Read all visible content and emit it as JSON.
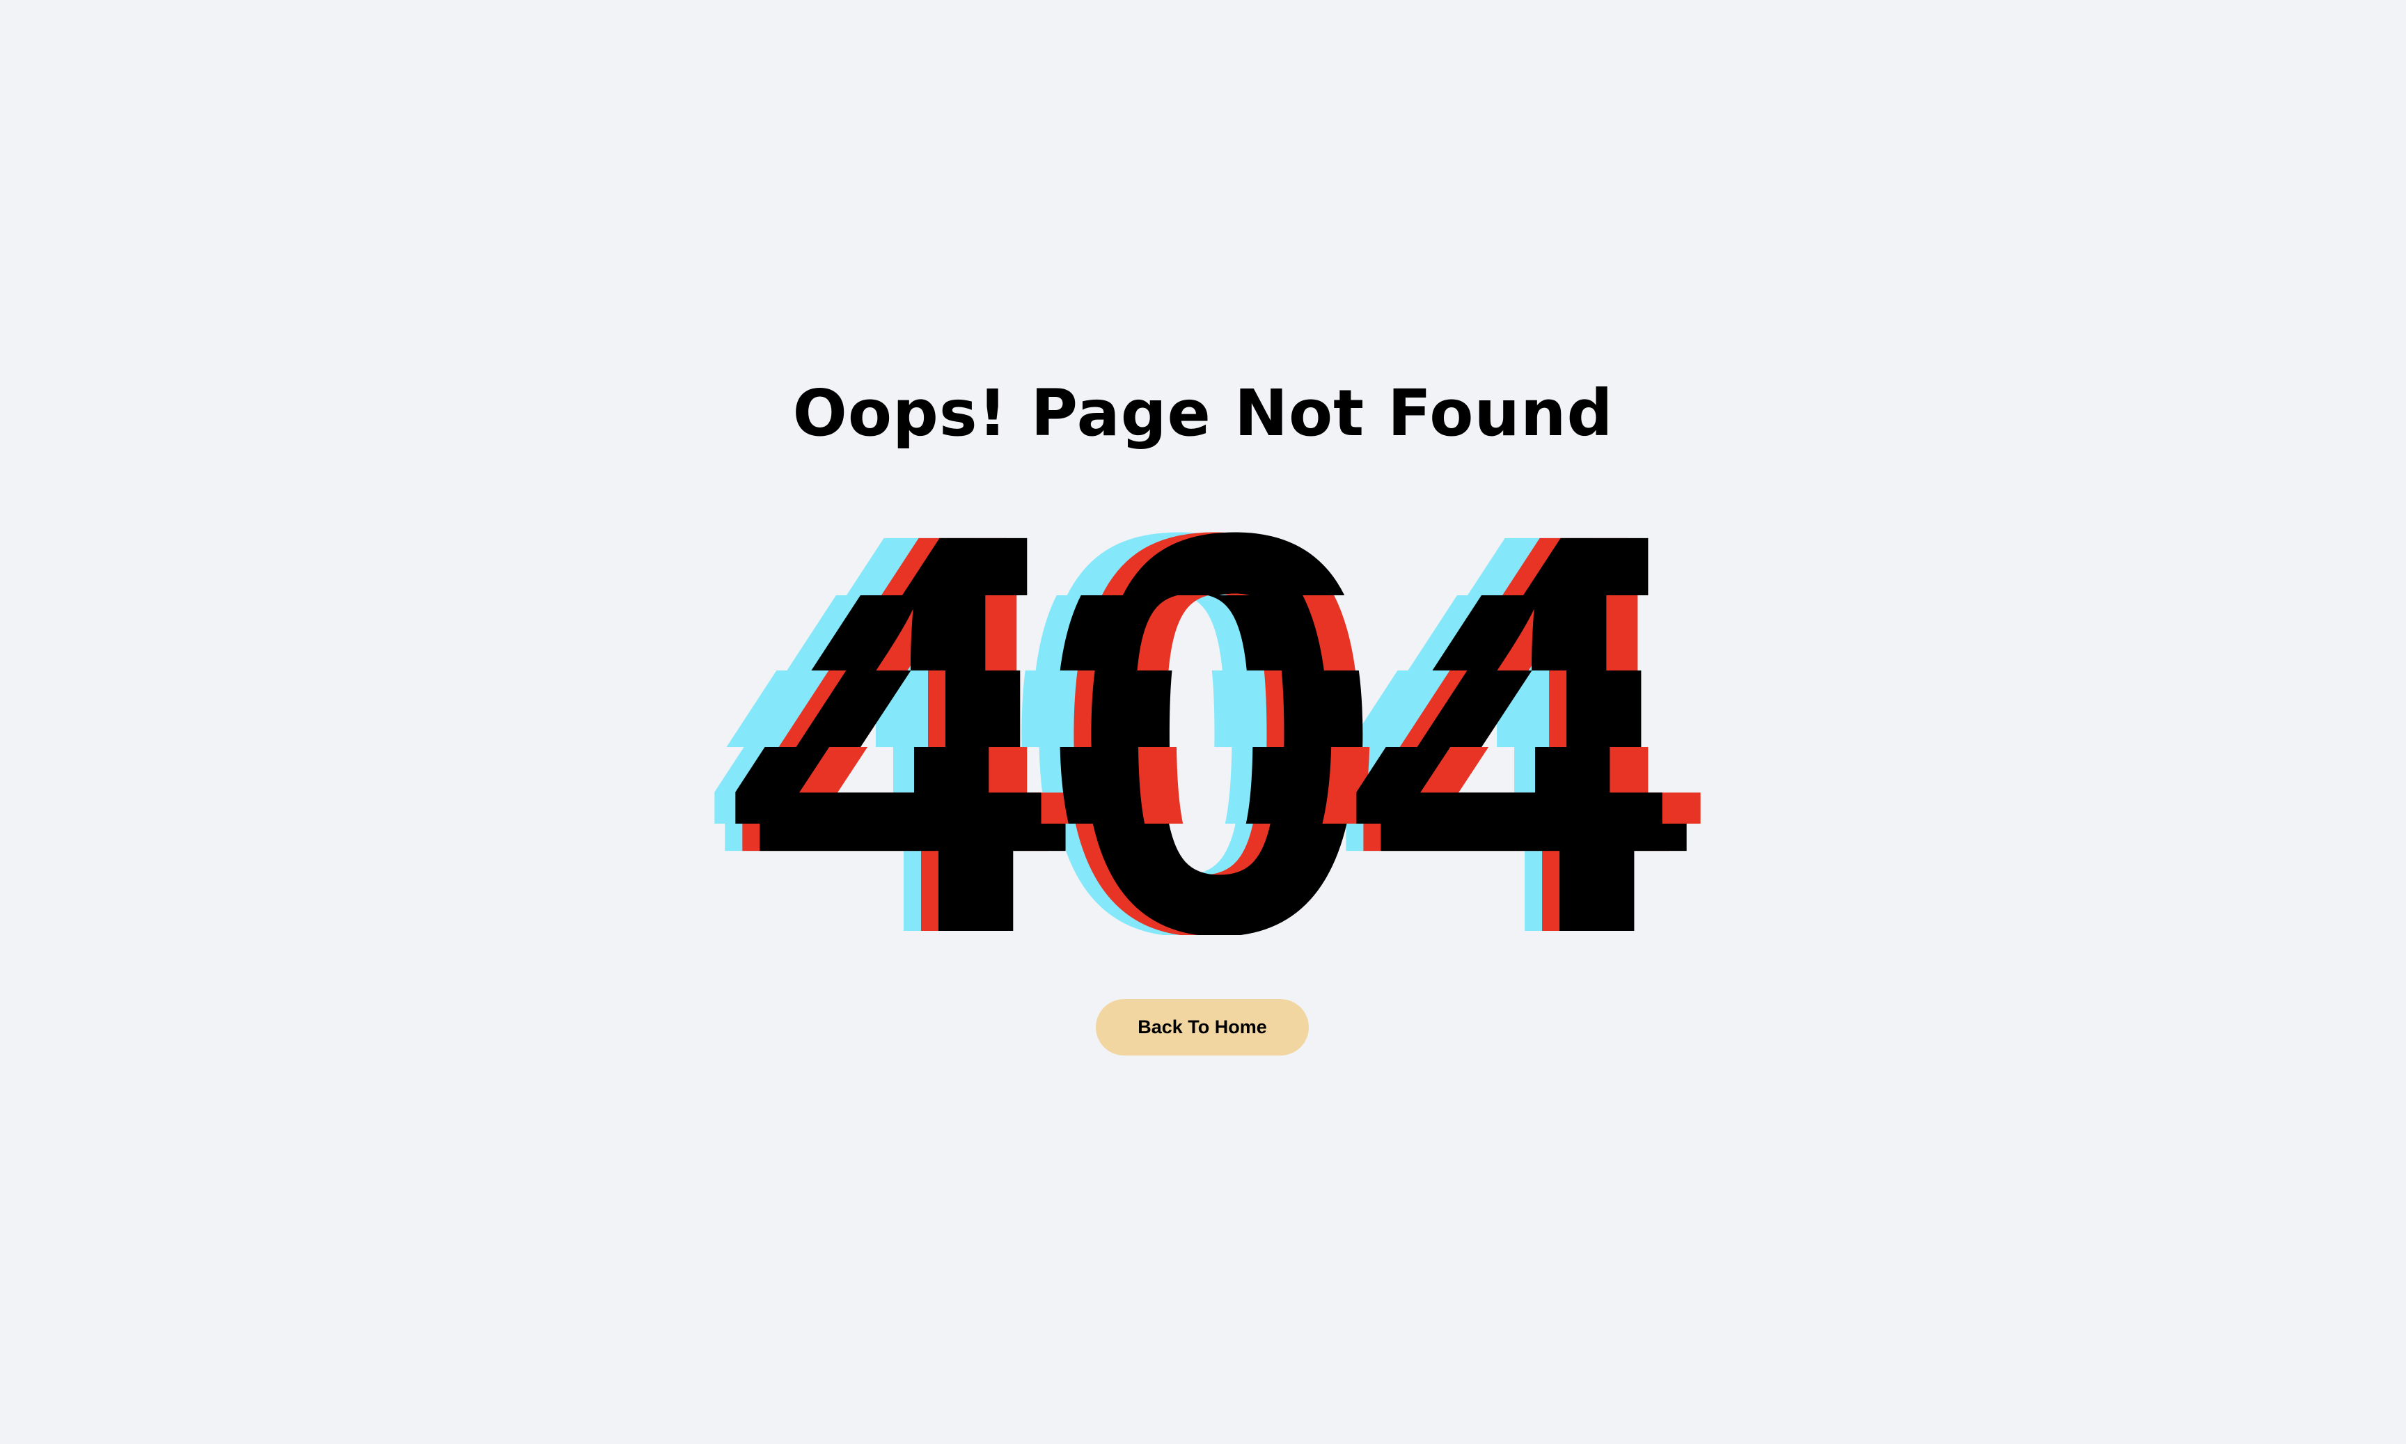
{
  "page": {
    "title": "Oops! Page Not Found",
    "error_code": "404",
    "back_button_label": "Back To Home"
  },
  "colors": {
    "background": "#f2f3f6",
    "glitch_cyan": "#84e8fa",
    "glitch_red": "#e83425",
    "text": "#000000",
    "button": "#f2d6a2"
  }
}
